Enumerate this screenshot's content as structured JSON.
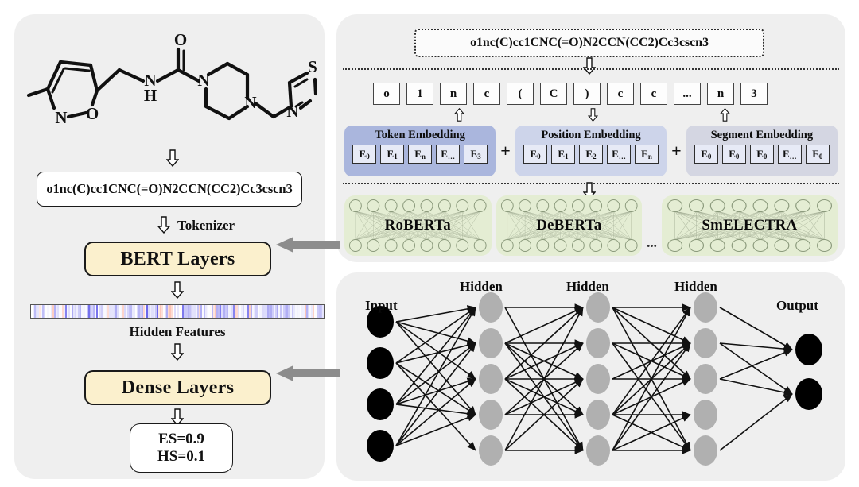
{
  "left_panel": {
    "molecule": {
      "name": "molecular-structure",
      "atoms": [
        "O",
        "N",
        "O",
        "N",
        "H",
        "N",
        "N",
        "S",
        "N"
      ],
      "description": "isoxazole-methyl urea piperazine thiazole structure"
    },
    "smiles": "o1nc(C)cc1CNC(=O)N2CCN(CC2)Cc3cscn3",
    "tokenizer_label": "Tokenizer",
    "bert_layers_label": "BERT Layers",
    "hidden_features_label": "Hidden Features",
    "dense_layers_label": "Dense Layers",
    "result": {
      "es": "ES=0.9",
      "hs": "HS=0.1"
    },
    "colors": {
      "box_fill": "#fbf0cd",
      "panel_bg": "#efefef"
    }
  },
  "right_top_panel": {
    "smiles": "o1nc(C)cc1CNC(=O)N2CCN(CC2)Cc3cscn3",
    "tokens": [
      "o",
      "1",
      "n",
      "c",
      "(",
      "C",
      ")",
      "c",
      "c",
      "...",
      "n",
      "3"
    ],
    "embeddings": [
      {
        "title": "Token Embedding",
        "cells": [
          "E0",
          "E1",
          "En",
          "E…",
          "E3"
        ],
        "subs": [
          "0",
          "1",
          "n",
          "…",
          "3"
        ],
        "color": "#aab6dd"
      },
      {
        "title": "Position Embedding",
        "cells": [
          "E0",
          "E1",
          "E2",
          "E…",
          "En"
        ],
        "subs": [
          "0",
          "1",
          "2",
          "…",
          "n"
        ],
        "color": "#cdd4ea"
      },
      {
        "title": "Segment Embedding",
        "cells": [
          "E0",
          "E0",
          "E0",
          "E…",
          "E0"
        ],
        "subs": [
          "0",
          "0",
          "0",
          "…",
          "0"
        ],
        "color": "#d4d6e2"
      }
    ],
    "plus_symbol": "+",
    "models": [
      "RoBERTa",
      "DeBERTa",
      "SmELECTRA"
    ],
    "models_ellipsis": "...",
    "model_card_color": "#e4edd3"
  },
  "right_bottom_panel": {
    "layer_labels": {
      "input": "Input",
      "hidden_1": "Hidden",
      "hidden_2": "Hidden",
      "hidden_3": "Hidden",
      "output": "Output"
    },
    "node_counts": {
      "input": 4,
      "hidden": 5,
      "output": 2
    },
    "node_colors": {
      "input_output": "#000000",
      "hidden": "#b0b0b0"
    }
  },
  "connectors": {
    "arrow_to_bert": "left-arrow",
    "arrow_to_dense": "left-arrow",
    "arrow_color": "#8c8c8c"
  }
}
